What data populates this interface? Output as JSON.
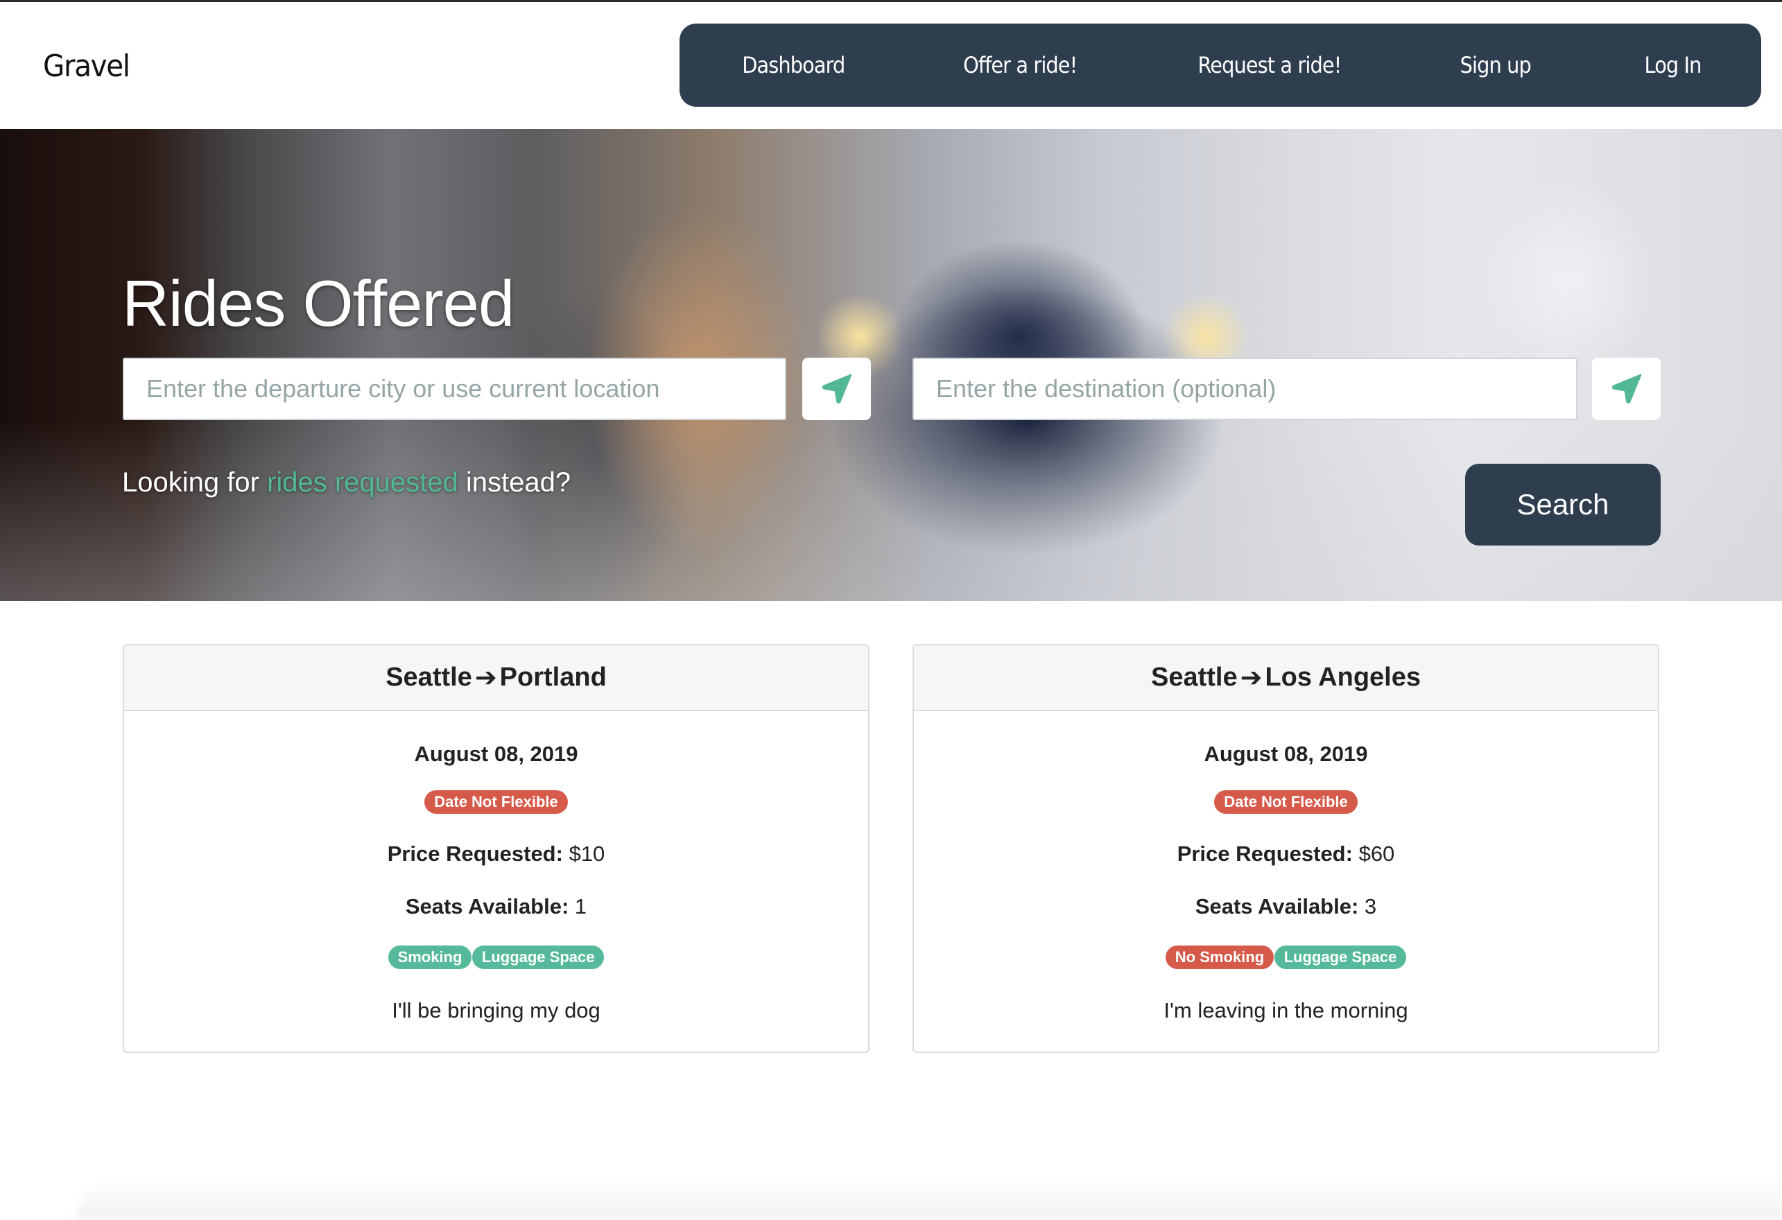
{
  "app": {
    "brand": "Gravel"
  },
  "nav": {
    "items": [
      {
        "label": "Dashboard"
      },
      {
        "label": "Offer a ride!"
      },
      {
        "label": "Request a ride!"
      },
      {
        "label": "Sign up"
      },
      {
        "label": "Log In"
      }
    ]
  },
  "hero": {
    "title": "Rides Offered",
    "departure": {
      "value": "",
      "placeholder": "Enter the departure city or use current location"
    },
    "destination": {
      "value": "",
      "placeholder": "Enter the destination (optional)"
    },
    "location_icon": "location-arrow-icon",
    "alt_prefix": "Looking for ",
    "alt_link": "rides requested",
    "alt_suffix": " instead?",
    "search_label": "Search"
  },
  "rides": [
    {
      "from": "Seattle",
      "to": "Portland",
      "date": "August 08, 2019",
      "flex_badge": "Date Not Flexible",
      "price_label": "Price Requested:",
      "price": "$10",
      "seats_label": "Seats Available:",
      "seats": "1",
      "amenities": [
        {
          "label": "Smoking",
          "status": "positive"
        },
        {
          "label": "Luggage Space",
          "status": "positive"
        }
      ],
      "note": "I'll be bringing my dog"
    },
    {
      "from": "Seattle",
      "to": "Los Angeles",
      "date": "August 08, 2019",
      "flex_badge": "Date Not Flexible",
      "price_label": "Price Requested:",
      "price": "$60",
      "seats_label": "Seats Available:",
      "seats": "3",
      "amenities": [
        {
          "label": "No Smoking",
          "status": "negative"
        },
        {
          "label": "Luggage Space",
          "status": "positive"
        }
      ],
      "note": "I'm leaving in the morning"
    }
  ],
  "colors": {
    "navy": "#2f3e4f",
    "accent_green": "#52b795",
    "badge_red": "#d65a4a",
    "badge_green": "#56b99b"
  }
}
